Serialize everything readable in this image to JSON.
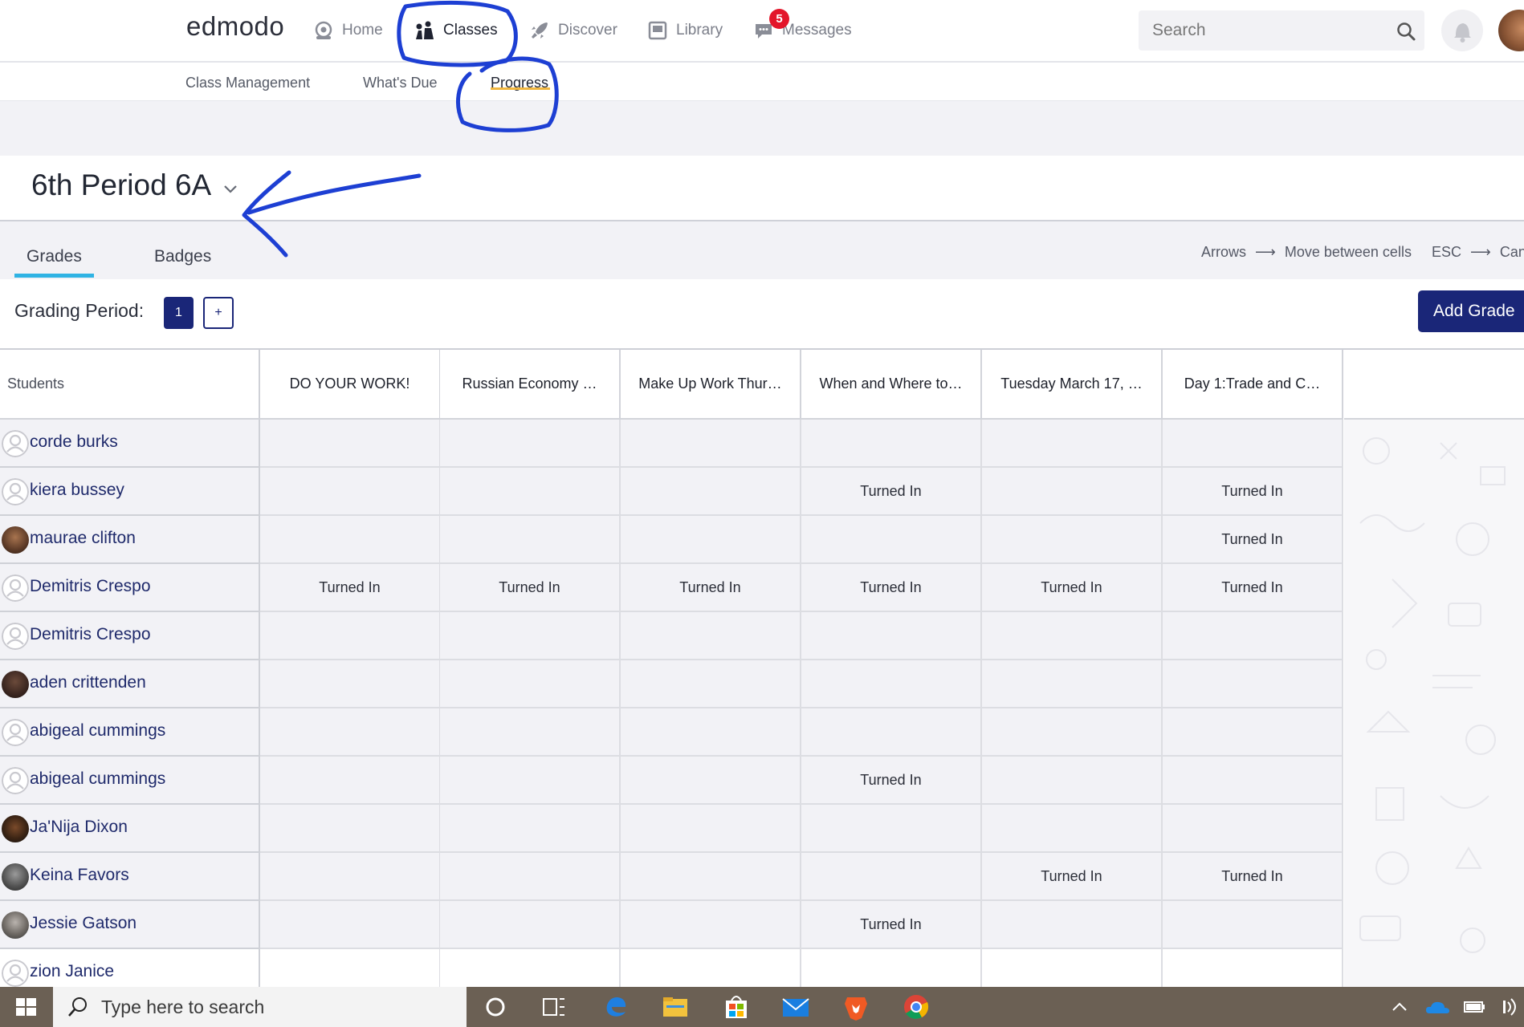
{
  "topbar": {
    "logo": "edmodo",
    "nav": [
      {
        "label": "Home"
      },
      {
        "label": "Classes"
      },
      {
        "label": "Discover"
      },
      {
        "label": "Library"
      },
      {
        "label": "Messages",
        "badge": "5"
      }
    ],
    "search_placeholder": "Search"
  },
  "subnav": {
    "tabs": [
      "Class Management",
      "What's Due",
      "Progress"
    ],
    "active": "Progress"
  },
  "class": {
    "name": "6th Period 6A"
  },
  "tabs": {
    "grades": "Grades",
    "badges": "Badges",
    "shortcuts": [
      "Arrows",
      "⟶",
      "Move between cells",
      "ESC",
      "⟶",
      "Cance"
    ]
  },
  "grading": {
    "label": "Grading Period:",
    "period": "1",
    "add": "+",
    "add_grade": "Add Grade"
  },
  "table": {
    "students_header": "Students",
    "columns": [
      "DO YOUR WORK!",
      "Russian Economy …",
      "Make Up Work Thur…",
      "When and Where to…",
      "Tuesday March 17, …",
      "Day 1:Trade and C…"
    ],
    "rows": [
      {
        "name": "corde burks",
        "avatar": "default",
        "cells": [
          "",
          "",
          "",
          "",
          "",
          ""
        ]
      },
      {
        "name": "kiera bussey",
        "avatar": "default",
        "cells": [
          "",
          "",
          "",
          "Turned In",
          "",
          "Turned In"
        ]
      },
      {
        "name": "maurae clifton",
        "avatar": "photo",
        "cells": [
          "",
          "",
          "",
          "",
          "",
          "Turned In"
        ]
      },
      {
        "name": "Demitris Crespo",
        "avatar": "default",
        "cells": [
          "Turned In",
          "Turned In",
          "Turned In",
          "Turned In",
          "Turned In",
          "Turned In"
        ]
      },
      {
        "name": "Demitris Crespo",
        "avatar": "default",
        "cells": [
          "",
          "",
          "",
          "",
          "",
          ""
        ]
      },
      {
        "name": "aden crittenden",
        "avatar": "photo",
        "cells": [
          "",
          "",
          "",
          "",
          "",
          ""
        ]
      },
      {
        "name": "abigeal cummings",
        "avatar": "default",
        "cells": [
          "",
          "",
          "",
          "",
          "",
          ""
        ]
      },
      {
        "name": "abigeal cummings",
        "avatar": "default",
        "cells": [
          "",
          "",
          "",
          "Turned In",
          "",
          ""
        ]
      },
      {
        "name": "Ja'Nija Dixon",
        "avatar": "photo",
        "cells": [
          "",
          "",
          "",
          "",
          "",
          ""
        ]
      },
      {
        "name": "Keina Favors",
        "avatar": "photo",
        "cells": [
          "",
          "",
          "",
          "",
          "Turned In",
          "Turned In"
        ]
      },
      {
        "name": "Jessie Gatson",
        "avatar": "photo",
        "cells": [
          "",
          "",
          "",
          "Turned In",
          "",
          ""
        ]
      },
      {
        "name": "zion Janice",
        "avatar": "default",
        "cells": [
          "",
          "",
          "",
          "",
          "",
          ""
        ]
      }
    ]
  },
  "taskbar": {
    "search_placeholder": "Type here to search",
    "icons": [
      "cortana-icon",
      "task-view-icon",
      "edge-icon",
      "file-explorer-icon",
      "store-icon",
      "mail-icon",
      "brave-icon",
      "chrome-icon"
    ]
  },
  "colors": {
    "primary": "#1a2678",
    "accent_blue": "#2fb3e4",
    "progress_underline": "#f1b63f",
    "badge": "#e3152a",
    "annotation_ink": "#1d3fd3"
  }
}
